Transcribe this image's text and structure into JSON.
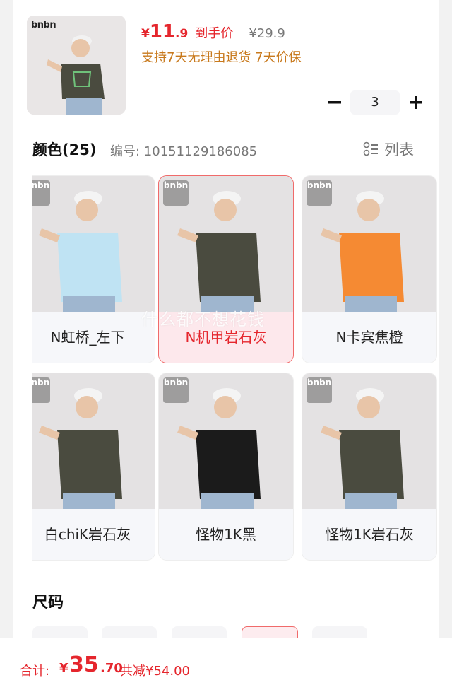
{
  "header": {
    "brand": "bnbn",
    "price_symbol": "¥",
    "price_int": "11",
    "price_dec": ".9",
    "price_tag": "到手价",
    "original_price": "¥29.9",
    "promises": "支持7天无理由退货  7天价保",
    "quantity": "3"
  },
  "color_section": {
    "title": "颜色(25)",
    "code": "编号: 10151129186085",
    "list_label": "列表",
    "watermark": "什么都不想花钱",
    "items": [
      {
        "label": "N虹桥_左下",
        "shirt": "#bfe3f3",
        "selected": false
      },
      {
        "label": "N机甲岩石灰",
        "shirt": "#4a4b3f",
        "selected": true
      },
      {
        "label": "N卡宾焦橙",
        "shirt": "#f58a33",
        "selected": false
      },
      {
        "label": "白chiK岩石灰",
        "shirt": "#4a4b3f",
        "selected": false
      },
      {
        "label": "怪物1K黑",
        "shirt": "#1b1b1b",
        "selected": false
      },
      {
        "label": "怪物1K岩石灰",
        "shirt": "#4a4b3f",
        "selected": false
      }
    ]
  },
  "size_section": {
    "title": "尺码"
  },
  "footer": {
    "total_label": "合计:",
    "symbol": "¥",
    "total_int": "35",
    "total_dec": ".70",
    "saving": "共减¥54.00"
  },
  "colors": {
    "accent_red": "#e5262d",
    "promise_orange": "#c8791c"
  }
}
